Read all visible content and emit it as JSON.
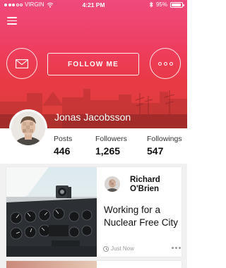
{
  "status_bar": {
    "carrier": "VIRGIN",
    "time": "4:21 PM",
    "battery": "95%",
    "battery_level": 0.95,
    "icons": [
      "signal-icon",
      "wifi-icon",
      "bluetooth-icon",
      "battery-icon"
    ]
  },
  "header": {
    "menu_icon": "hamburger-menu-icon",
    "mail_icon": "mail-icon",
    "follow_label": "FOLLOW ME",
    "more_icon": "more-dots-icon"
  },
  "profile": {
    "name": "Jonas Jacobsson",
    "avatar": "avatar"
  },
  "stats": [
    {
      "label": "Posts",
      "value": "446"
    },
    {
      "label": "Followers",
      "value": "1,265"
    },
    {
      "label": "Followings",
      "value": "547"
    }
  ],
  "feed": {
    "cards": [
      {
        "image": "cockpit-photo",
        "author": "Richard O'Brien",
        "title": "Working for a Nuclear Free City",
        "time": "Just Now",
        "clock_icon": "clock-icon",
        "more_icon": "more-dots-icon"
      }
    ]
  },
  "colors": {
    "gradient_top": "#ef4a7d",
    "gradient_mid": "#ee3e5f",
    "gradient_bottom": "#d84036",
    "text_dark": "#111111",
    "muted": "#9a9a9a",
    "feed_bg": "#f1f1f1"
  }
}
